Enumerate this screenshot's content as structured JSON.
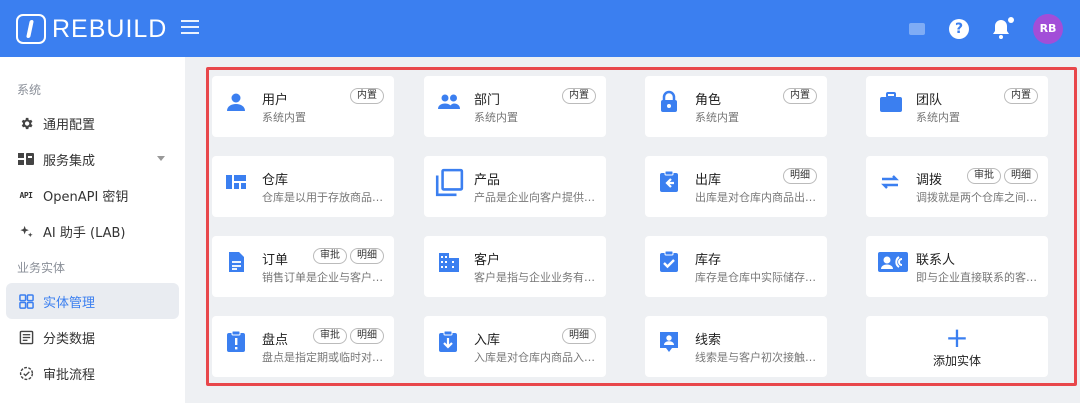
{
  "header": {
    "logo_text": "REBUILD",
    "avatar_initials": "RB",
    "accent_color": "#3b7ff0"
  },
  "sidebar": {
    "section_system": "系统",
    "section_business": "业务实体",
    "items": [
      {
        "label": "通用配置",
        "icon": "gear-icon"
      },
      {
        "label": "服务集成",
        "icon": "integration-icon"
      },
      {
        "label": "OpenAPI 密钥",
        "icon": "api-icon"
      },
      {
        "label": "AI 助手 (LAB)",
        "icon": "sparkle-icon"
      },
      {
        "label": "实体管理",
        "icon": "grid-icon"
      },
      {
        "label": "分类数据",
        "icon": "classification-icon"
      },
      {
        "label": "审批流程",
        "icon": "approval-icon"
      }
    ]
  },
  "entities": [
    {
      "title": "用户",
      "desc": "系统内置",
      "tags": [
        "内置"
      ],
      "icon": "user-icon"
    },
    {
      "title": "部门",
      "desc": "系统内置",
      "tags": [
        "内置"
      ],
      "icon": "group-icon"
    },
    {
      "title": "角色",
      "desc": "系统内置",
      "tags": [
        "内置"
      ],
      "icon": "lock-icon"
    },
    {
      "title": "团队",
      "desc": "系统内置",
      "tags": [
        "内置"
      ],
      "icon": "briefcase-icon"
    },
    {
      "title": "仓库",
      "desc": "仓库是以用于存放商品的…",
      "tags": [],
      "icon": "warehouse-icon"
    },
    {
      "title": "产品",
      "desc": "产品是企业向客户提供的…",
      "tags": [],
      "icon": "product-icon"
    },
    {
      "title": "出库",
      "desc": "出库是对仓库内商品出库…",
      "tags": [
        "明细"
      ],
      "icon": "outbound-icon"
    },
    {
      "title": "调拨",
      "desc": "调拨就是两个仓库之间的…",
      "tags": [
        "审批",
        "明细"
      ],
      "icon": "transfer-icon"
    },
    {
      "title": "订单",
      "desc": "销售订单是企业与客户之…",
      "tags": [
        "审批",
        "明细"
      ],
      "icon": "order-icon"
    },
    {
      "title": "客户",
      "desc": "客户是指与企业业务有往…",
      "tags": [],
      "icon": "building-icon"
    },
    {
      "title": "库存",
      "desc": "库存是仓库中实际储存的…",
      "tags": [],
      "icon": "inventory-icon"
    },
    {
      "title": "联系人",
      "desc": "即与企业直接联系的客户…",
      "tags": [],
      "icon": "contact-icon"
    },
    {
      "title": "盘点",
      "desc": "盘点是指定期或临时对库…",
      "tags": [
        "审批",
        "明细"
      ],
      "icon": "stocktake-icon"
    },
    {
      "title": "入库",
      "desc": "入库是对仓库内商品入库…",
      "tags": [
        "明细"
      ],
      "icon": "inbound-icon"
    },
    {
      "title": "线索",
      "desc": "线索是与客户初次接触获…",
      "tags": [],
      "icon": "lead-icon"
    }
  ],
  "add_entity": {
    "label": "添加实体",
    "icon": "plus-icon"
  }
}
